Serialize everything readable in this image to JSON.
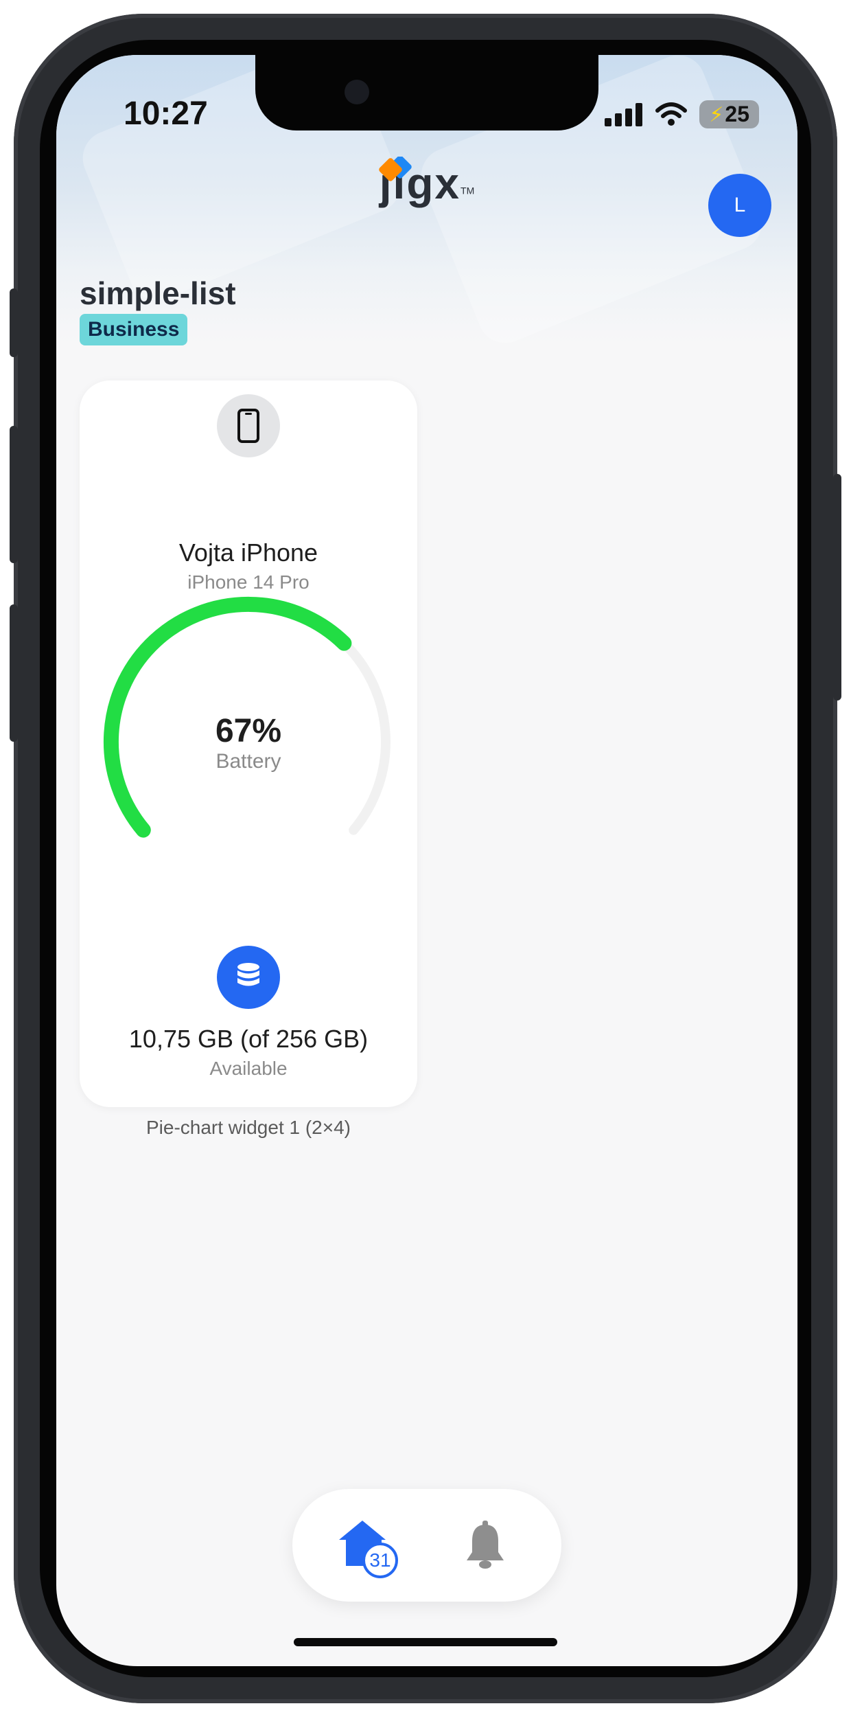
{
  "status_bar": {
    "time": "10:27",
    "battery": "25"
  },
  "header": {
    "logo": "jigx",
    "trademark": "TM",
    "avatar_initial": "L",
    "title": "simple-list",
    "tag": "Business"
  },
  "card": {
    "device_name": "Vojta iPhone",
    "device_model": "iPhone 14 Pro",
    "battery_value": "67%",
    "battery_label": "Battery",
    "battery_level": 0.67,
    "storage_value": "10,75 GB (of 256 GB)",
    "storage_label": "Available",
    "gauge_color": "#22dd44",
    "track_color": "#f1f1f1"
  },
  "caption": "Pie-chart widget 1 (2×4)",
  "tabbar": {
    "home_badge": "31",
    "accent": "#2468f2",
    "inactive": "#8e8e8e"
  }
}
